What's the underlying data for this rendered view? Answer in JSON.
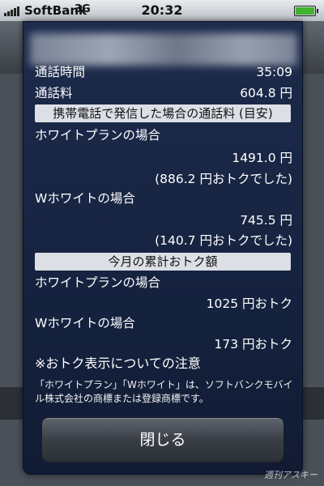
{
  "status_bar": {
    "carrier": "SoftBank",
    "network": "3G",
    "time": "20:32"
  },
  "sheet": {
    "call_time_label": "通話時間",
    "call_time_value": "35:09",
    "call_fee_label": "通話料",
    "call_fee_value": "604.8 円",
    "section_mobile": "携帯電話で発信した場合の通話料 (目安)",
    "white_plan_label": "ホワイトプランの場合",
    "white_plan_value": "1491.0 円",
    "white_plan_saving": "(886.2 円おトクでした)",
    "w_white_label": "Wホワイトの場合",
    "w_white_value": "745.5 円",
    "w_white_saving": "(140.7 円おトクでした)",
    "section_monthly": "今月の累計おトク額",
    "monthly_white_plan_label": "ホワイトプランの場合",
    "monthly_white_plan_value": "1025 円おトク",
    "monthly_w_white_label": "Wホワイトの場合",
    "monthly_w_white_value": "173 円おトク",
    "notice_title": "※おトク表示についての注意",
    "notice_body": "「ホワイトプラン」「Wホワイト」は、ソフトバンクモバイル株式会社の商標または登録商標です。",
    "close_label": "閉じる"
  },
  "watermark": "週刊アスキー"
}
